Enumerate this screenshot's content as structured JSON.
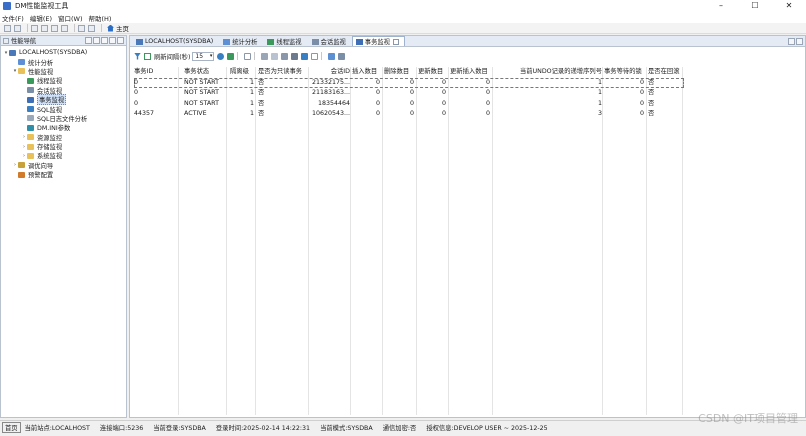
{
  "window": {
    "title": "DM性能监视工具",
    "controls": [
      "–",
      "☐",
      "✕"
    ]
  },
  "menu": [
    "文件(F)",
    "编辑(E)",
    "窗口(W)",
    "帮助(H)"
  ],
  "toolbar": {
    "home_label": "主页"
  },
  "nav_panel": {
    "title": "性能导航",
    "tree": [
      {
        "label": "LOCALHOST(SYSDBA)",
        "level": 0,
        "expander": "▾",
        "icon": "server-icon"
      },
      {
        "label": "统计分析",
        "level": 1,
        "expander": "",
        "icon": "stat-icon"
      },
      {
        "label": "性能监视",
        "level": 1,
        "expander": "▾",
        "icon": "folder-icon"
      },
      {
        "label": "线程监视",
        "level": 2,
        "expander": "",
        "icon": "thread-icon"
      },
      {
        "label": "会话监视",
        "level": 2,
        "expander": "",
        "icon": "session-icon"
      },
      {
        "label": "事务监视",
        "level": 2,
        "expander": "",
        "icon": "transaction-icon",
        "selected": true
      },
      {
        "label": "SQL监视",
        "level": 2,
        "expander": "",
        "icon": "sql-icon"
      },
      {
        "label": "SQL日志文件分析",
        "level": 2,
        "expander": "",
        "icon": "log-icon"
      },
      {
        "label": "DM.INI参数",
        "level": 2,
        "expander": "",
        "icon": "ini-icon"
      },
      {
        "label": "资源监控",
        "level": 2,
        "expander": "›",
        "icon": "folder-icon"
      },
      {
        "label": "存储监视",
        "level": 2,
        "expander": "›",
        "icon": "folder-icon"
      },
      {
        "label": "系统监视",
        "level": 2,
        "expander": "›",
        "icon": "folder-icon"
      },
      {
        "label": "调优向导",
        "level": 1,
        "expander": "›",
        "icon": "tune-icon"
      },
      {
        "label": "预警配置",
        "level": 1,
        "expander": "",
        "icon": "alarm-icon"
      }
    ]
  },
  "editor_tabs": [
    {
      "label": "LOCALHOST(SYSDBA)",
      "icon": "server-icon",
      "active": false
    },
    {
      "label": "统计分析",
      "icon": "stat-icon",
      "active": false
    },
    {
      "label": "线程监视",
      "icon": "thread-icon",
      "active": false
    },
    {
      "label": "会话监视",
      "icon": "session-icon",
      "active": false
    },
    {
      "label": "事务监视",
      "icon": "transaction-icon",
      "active": true
    }
  ],
  "tx_toolbar": {
    "refresh_label": "刷新间隔(秒)",
    "refresh_value": "15"
  },
  "table": {
    "columns": [
      "事务ID",
      "事务状态",
      "隔离级",
      "是否为只读事务",
      "会话ID",
      "插入数目",
      "删除数目",
      "更新数目",
      "更新插入数目",
      "当前UNDO记录的递增序列号",
      "事务等待的锁",
      "是否在回滚"
    ],
    "rows": [
      [
        "0",
        "NOT START",
        "1",
        "否",
        "21332175...",
        "0",
        "0",
        "0",
        "0",
        "1",
        "0",
        "否"
      ],
      [
        "0",
        "NOT START",
        "1",
        "否",
        "21183163...",
        "0",
        "0",
        "0",
        "0",
        "1",
        "0",
        "否"
      ],
      [
        "0",
        "NOT START",
        "1",
        "否",
        "18354464",
        "0",
        "0",
        "0",
        "0",
        "1",
        "0",
        "否"
      ],
      [
        "44357",
        "ACTIVE",
        "1",
        "否",
        "10620543...",
        "0",
        "0",
        "0",
        "0",
        "3",
        "0",
        "否"
      ]
    ]
  },
  "status_bar": [
    "首页",
    "当前站点:LOCALHOST",
    "连接端口:5236",
    "当前登录:SYSDBA",
    "登录时间:2025-02-14 14:22:31",
    "当前模式:SYSDBA",
    "通信加密:否",
    "授权信息:DEVELOP USER ~ 2025-12-25"
  ],
  "watermark": "CSDN @IT项目管理"
}
